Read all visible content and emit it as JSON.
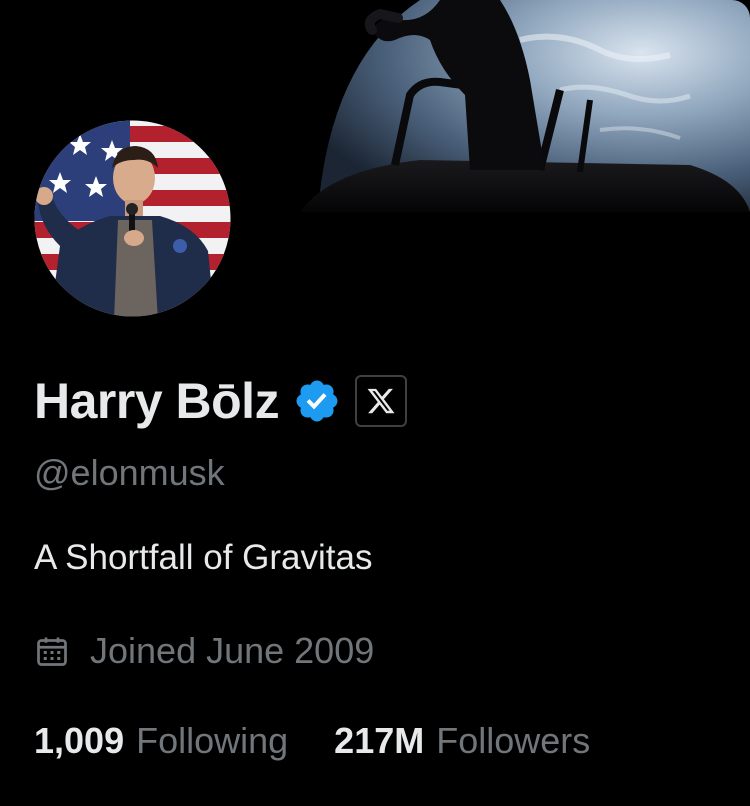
{
  "profile": {
    "display_name": "Harry Bōlz",
    "handle": "@elonmusk",
    "bio": "A Shortfall of Gravitas",
    "joined": "Joined June 2009",
    "verified": true,
    "affiliate_badge_icon": "x-logo-icon"
  },
  "stats": {
    "following_count": "1,009",
    "following_label": "Following",
    "followers_count": "217M",
    "followers_label": "Followers"
  },
  "icons": {
    "verified": "verified-badge-icon",
    "calendar": "calendar-icon"
  },
  "colors": {
    "background": "#000000",
    "primary_text": "#e7e9ea",
    "secondary_text": "#71767b",
    "verified_blue": "#1d9bf0",
    "badge_border": "#3e4144"
  }
}
